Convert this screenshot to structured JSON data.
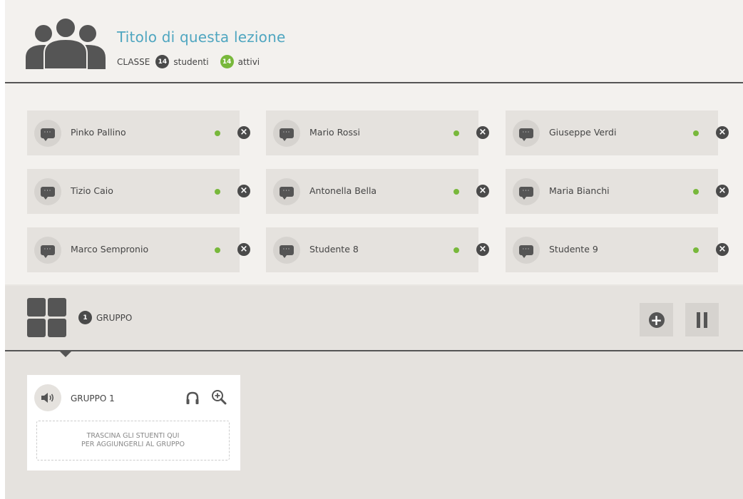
{
  "header": {
    "title": "Titolo di questa lezione",
    "class_label": "CLASSE",
    "students_count": "14",
    "students_label": "studenti",
    "active_count": "14",
    "active_label": "attivi"
  },
  "students": [
    {
      "name": "Pinko Pallino",
      "online": true
    },
    {
      "name": "Mario Rossi",
      "online": true
    },
    {
      "name": "Giuseppe Verdi",
      "online": true
    },
    {
      "name": "Tizio Caio",
      "online": true
    },
    {
      "name": "Antonella Bella",
      "online": true
    },
    {
      "name": "Maria Bianchi",
      "online": true
    },
    {
      "name": "Marco Sempronio",
      "online": true
    },
    {
      "name": "Studente 8",
      "online": true
    },
    {
      "name": "Studente 9",
      "online": true
    }
  ],
  "groups_bar": {
    "count": "1",
    "label": "GRUPPO"
  },
  "group_card": {
    "name": "GRUPPO 1",
    "drop_line1": "TRASCINA GLI STUENTI QUI",
    "drop_line2": "PER AGGIUNGERLI AL GRUPPO"
  },
  "icons": {
    "class": "people-icon",
    "chat": "chat-icon",
    "remove": "remove-icon",
    "groups": "grid-icon",
    "add": "plus-circle-icon",
    "pause": "pause-icon",
    "speaker": "speaker-icon",
    "headphones": "headphones-icon",
    "zoom": "zoom-in-icon"
  },
  "colors": {
    "title": "#4fa6c0",
    "online": "#78b83b",
    "dark": "#4a4a4a"
  }
}
